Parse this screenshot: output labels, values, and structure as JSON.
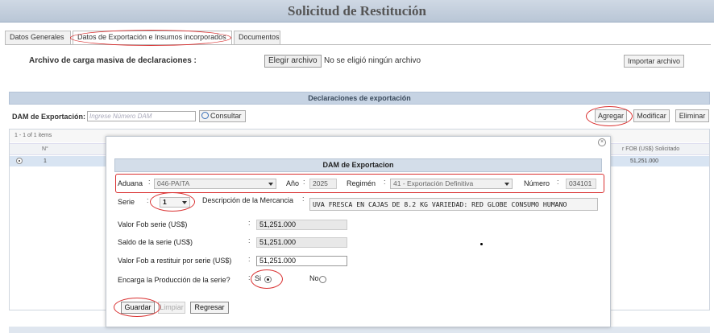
{
  "page": {
    "title": "Solicitud de Restitución"
  },
  "tabs": [
    {
      "label": "Datos Generales"
    },
    {
      "label": "Datos de Exportación e Insumos incorporados"
    },
    {
      "label": "Documentos"
    }
  ],
  "upload": {
    "label": "Archivo de carga masiva de declaraciones :",
    "choose_button": "Elegir archivo",
    "status": "No se eligió ningún archivo",
    "import_button": "Importar archivo"
  },
  "section": {
    "title": "Declaraciones de exportación"
  },
  "dam_search": {
    "label": "DAM de Exportación:",
    "placeholder": "Ingrese Número DAM",
    "consult_button": "Consultar"
  },
  "actions": {
    "add": "Agregar",
    "modify": "Modificar",
    "delete": "Eliminar"
  },
  "grid": {
    "pager": "1 - 1 of 1 items",
    "header_n": "N°",
    "header_fob": "r FOB (US$) Solicitado",
    "rows": [
      {
        "n": "1",
        "fob": "51,251.000"
      }
    ]
  },
  "modal": {
    "title": "DAM de Exportacion",
    "aduana_label": "Aduana",
    "aduana_value": "046-PAITA",
    "anio_label": "Año",
    "anio_value": "2025",
    "regimen_label": "Regimén",
    "regimen_value": "41 - Exportación Definitiva",
    "numero_label": "Número",
    "numero_value": "034101",
    "serie_label": "Serie",
    "serie_value": "1",
    "desc_label": "Descripción de la Mercancia",
    "desc_value": "UVA FRESCA EN CAJAS DE 8.2 KG VARIEDAD: RED GLOBE CONSUMO HUMANO",
    "valor_fob_label": "Valor Fob serie (US$)",
    "valor_fob_value": "51,251.000",
    "saldo_label": "Saldo de la serie (US$)",
    "saldo_value": "51,251.000",
    "restituir_label": "Valor Fob a restituir por serie (US$)",
    "restituir_value": "51,251.000",
    "encarga_label": "Encarga la Producción de la serie?",
    "si_label": "Si",
    "no_label": "No",
    "encarga_selected": "Si",
    "save_button": "Guardar",
    "clear_button": "Limpiar",
    "back_button": "Regresar"
  },
  "colors": {
    "annotation": "#d93030",
    "header_bg": "#c6d3e3"
  }
}
